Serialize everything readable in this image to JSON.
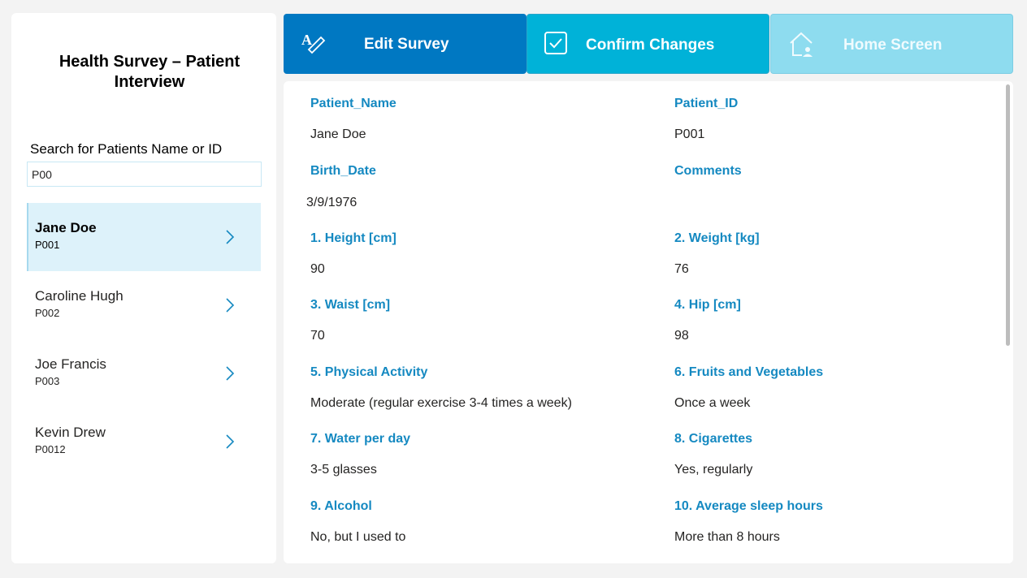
{
  "sidebar": {
    "title": "Health Survey – Patient Interview",
    "search_label": "Search for Patients Name or ID",
    "search_value": "P00",
    "patients": [
      {
        "name": "Jane Doe",
        "id": "P001",
        "selected": true
      },
      {
        "name": "Caroline Hugh",
        "id": "P002",
        "selected": false
      },
      {
        "name": "Joe Francis",
        "id": "P003",
        "selected": false
      },
      {
        "name": "Kevin Drew",
        "id": "P0012",
        "selected": false
      }
    ]
  },
  "toolbar": {
    "edit_label": "Edit Survey",
    "confirm_label": "Confirm Changes",
    "home_label": "Home Screen",
    "colors": {
      "edit": "#0078c2",
      "confirm": "#00b2d8",
      "home": "#8edcef"
    }
  },
  "form": {
    "fields": [
      {
        "label": "Patient_Name",
        "value": "Jane Doe"
      },
      {
        "label": "Patient_ID",
        "value": "P001"
      },
      {
        "label": "Birth_Date",
        "value": "3/9/1976"
      },
      {
        "label": "Comments",
        "value": ""
      },
      {
        "label": "1. Height [cm]",
        "value": "90"
      },
      {
        "label": "2. Weight [kg]",
        "value": "76"
      },
      {
        "label": "3. Waist [cm]",
        "value": "70"
      },
      {
        "label": "4. Hip [cm]",
        "value": "98"
      },
      {
        "label": "5. Physical Activity",
        "value": "Moderate (regular exercise 3-4 times a week)"
      },
      {
        "label": "6. Fruits and Vegetables",
        "value": "Once a week"
      },
      {
        "label": "7. Water per day",
        "value": "3-5 glasses"
      },
      {
        "label": "8. Cigarettes",
        "value": "Yes, regularly"
      },
      {
        "label": "9. Alcohol",
        "value": "No, but I used to"
      },
      {
        "label": "10. Average sleep hours",
        "value": "More than 8 hours"
      }
    ],
    "label_color": "#1589c1"
  }
}
